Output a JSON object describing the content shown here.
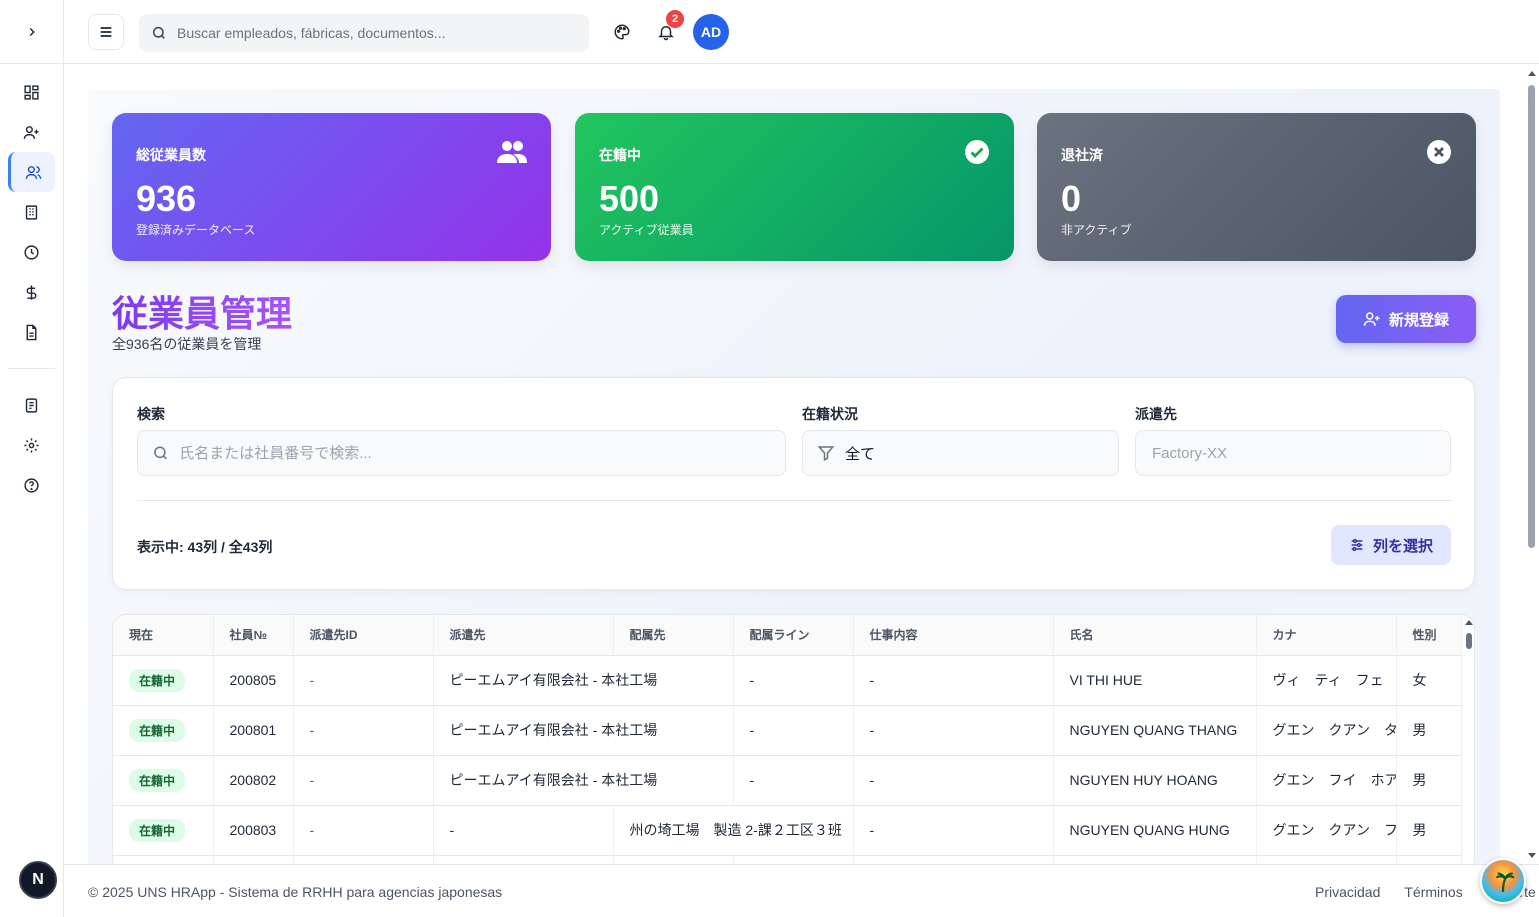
{
  "topbar": {
    "search_placeholder": "Buscar empleados, fábricas, documentos...",
    "notification_count": "2",
    "avatar_initials": "AD"
  },
  "rail": {
    "items": [
      "dashboard-icon",
      "user-plus-icon",
      "users-icon",
      "building-icon",
      "clock-icon",
      "dollar-icon",
      "document-icon",
      "report-icon",
      "settings-icon",
      "help-icon"
    ],
    "active_item": "users-icon",
    "bottom_badge": "N"
  },
  "cards": [
    {
      "label": "総従業員数",
      "value": "936",
      "sub": "登録済みデータベース",
      "icon": "users-icon"
    },
    {
      "label": "在籍中",
      "value": "500",
      "sub": "アクティブ従業員",
      "icon": "check-circle-icon"
    },
    {
      "label": "退社済",
      "value": "0",
      "sub": "非アクティブ",
      "icon": "x-circle-icon"
    }
  ],
  "page": {
    "title": "従業員管理",
    "subtitle": "全936名の従業員を管理",
    "new_button": "新規登録"
  },
  "filters": {
    "search_label": "検索",
    "search_placeholder": "氏名または社員番号で検索...",
    "status_label": "在籍状況",
    "status_value": "全て",
    "dispatch_label": "派遣先",
    "dispatch_placeholder": "Factory-XX",
    "showing": "表示中: 43列 / 全43列",
    "columns_button": "列を選択"
  },
  "table": {
    "headers": [
      "現在",
      "社員№",
      "派遣先ID",
      "派遣先",
      "配属先",
      "配属ライン",
      "仕事内容",
      "氏名",
      "カナ",
      "性別"
    ],
    "rows": [
      [
        "在籍中",
        "200805",
        "-",
        "ピーエムアイ有限会社 - 本社工場",
        "",
        "-",
        "-",
        "VI THI HUE",
        "ヴィ　ティ　フェ",
        "女"
      ],
      [
        "在籍中",
        "200801",
        "-",
        "ピーエムアイ有限会社 - 本社工場",
        "",
        "-",
        "-",
        "NGUYEN QUANG THANG",
        "グエン　クアン　タン",
        "男"
      ],
      [
        "在籍中",
        "200802",
        "-",
        "ピーエムアイ有限会社 - 本社工場",
        "",
        "-",
        "-",
        "NGUYEN HUY HOANG",
        "グエン　フイ　ホアン",
        "男"
      ],
      [
        "在籍中",
        "200803",
        "-",
        "-",
        "州の埼工場　製造 2-課２工区３班",
        "",
        "-",
        "NGUYEN QUANG HUNG",
        "グエン　クアン　フン",
        "男"
      ]
    ]
  },
  "footer": {
    "copyright": "© 2025 UNS HRApp - Sistema de RRHH para agencias japonesas",
    "links": [
      "Privacidad",
      "Términos",
      "Soporte"
    ]
  },
  "colors": {
    "accent": "#6366f1",
    "active_green": "#22c55e",
    "danger": "#ef4444",
    "avatar_blue": "#2563eb"
  }
}
